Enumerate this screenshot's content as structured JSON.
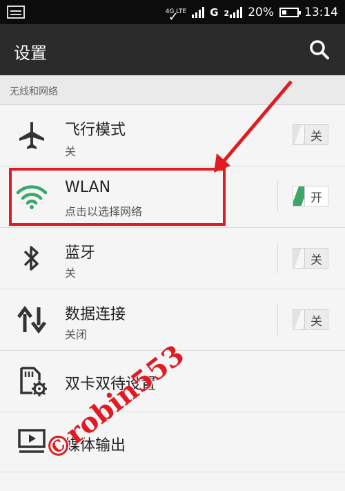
{
  "status_bar": {
    "network": "4G LTE",
    "sim2": "G",
    "sim2_index": "2",
    "battery": "20%",
    "time": "13:14"
  },
  "action_bar": {
    "title": "设置"
  },
  "section": {
    "header": "无线和网络"
  },
  "rows": [
    {
      "title": "飞行模式",
      "subtitle": "关",
      "toggle": "关",
      "icon": "airplane-icon"
    },
    {
      "title": "WLAN",
      "subtitle": "点击以选择网络",
      "toggle": "开",
      "icon": "wifi-icon"
    },
    {
      "title": "蓝牙",
      "subtitle": "关",
      "toggle": "关",
      "icon": "bluetooth-icon"
    },
    {
      "title": "数据连接",
      "subtitle": "关闭",
      "toggle": "关",
      "icon": "data-arrows-icon"
    },
    {
      "title": "双卡双待设置",
      "icon": "sim-settings-icon"
    },
    {
      "title": "媒体输出",
      "icon": "media-output-icon"
    }
  ],
  "watermark": "©robin553",
  "colors": {
    "accent_green": "#3aa66a",
    "highlight_red": "#e01b22",
    "action_bar": "#2b2b2b",
    "status_bar": "#0c0c0c"
  }
}
